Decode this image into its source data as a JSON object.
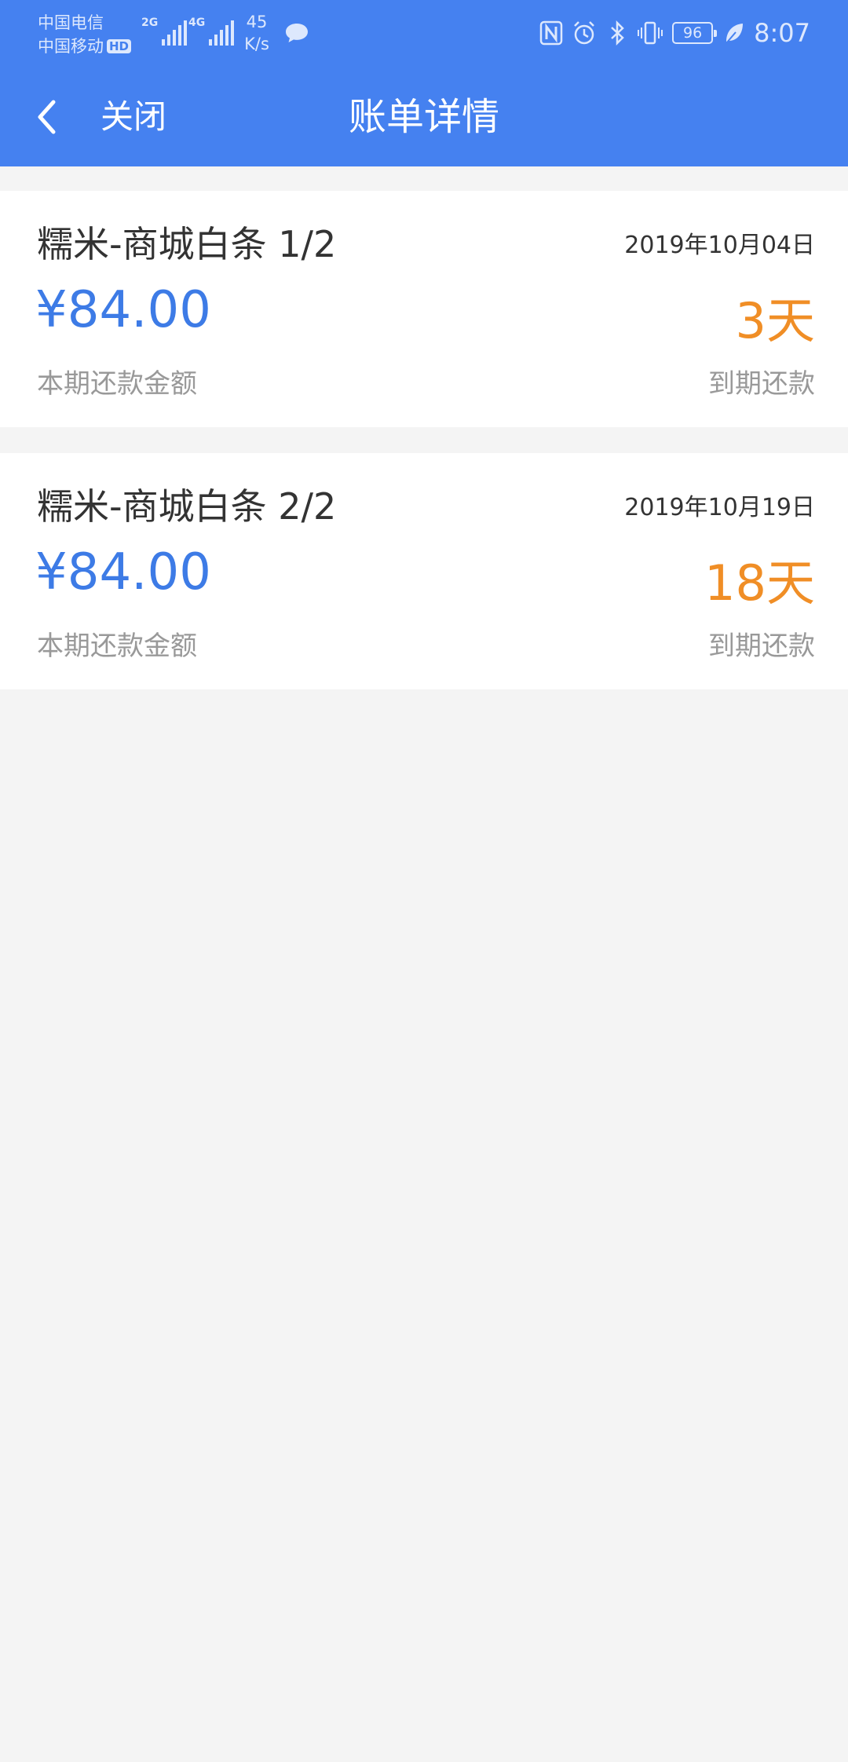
{
  "colors": {
    "header_bg": "#4581f0",
    "page_bg": "#f4f4f4",
    "amount": "#3d7be6",
    "days": "#f08e26",
    "muted_text": "#999999"
  },
  "status_bar": {
    "carrier_1": "中国电信",
    "carrier_2": "中国移动",
    "hd_badge": "HD",
    "signal_1_tag": "2G",
    "signal_2_tag": "4G",
    "net_speed_value": "45",
    "net_speed_unit": "K/s",
    "battery": "96",
    "time": "8:07",
    "icons": [
      "message-icon",
      "nfc-icon",
      "alarm-icon",
      "bluetooth-icon",
      "vibrate-icon",
      "battery-icon",
      "leaf-icon"
    ]
  },
  "header": {
    "back_icon": "chevron-left-icon",
    "close_label": "关闭",
    "title": "账单详情"
  },
  "bills": [
    {
      "title": "糯米-商城白条 1/2",
      "date": "2019年10月04日",
      "amount": "¥84.00",
      "amount_label": "本期还款金额",
      "days": "3天",
      "due_label": "到期还款"
    },
    {
      "title": "糯米-商城白条 2/2",
      "date": "2019年10月19日",
      "amount": "¥84.00",
      "amount_label": "本期还款金额",
      "days": "18天",
      "due_label": "到期还款"
    }
  ]
}
